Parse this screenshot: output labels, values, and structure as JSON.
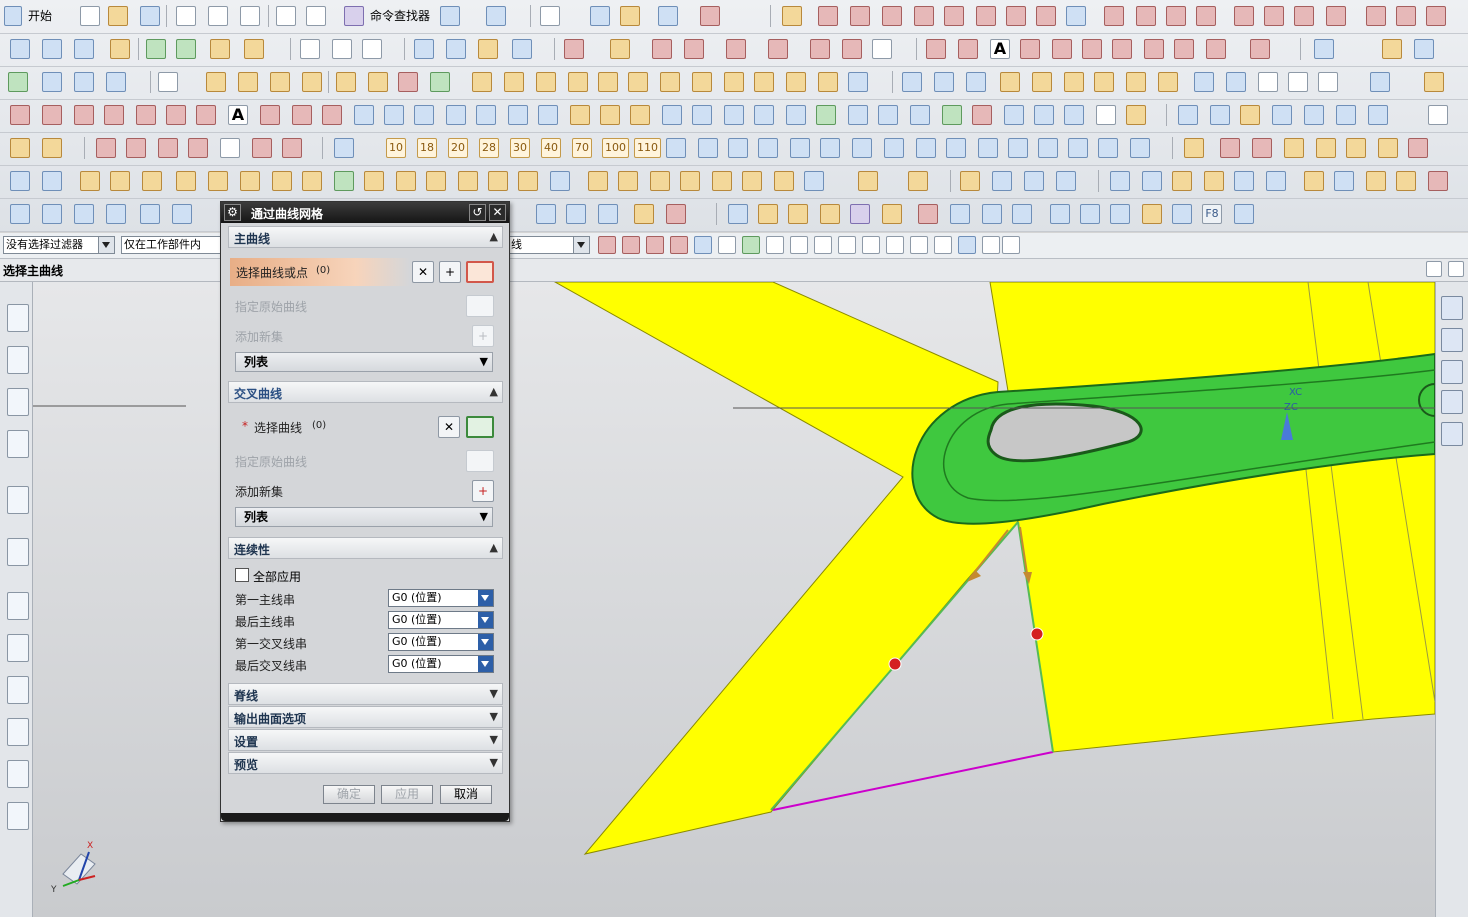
{
  "toolbar": {
    "start_label": "开始",
    "command_finder_label": "命令查找器",
    "number_buttons": [
      "10",
      "18",
      "20",
      "28",
      "30",
      "40",
      "70",
      "100",
      "110"
    ],
    "f8_label": "F8",
    "swatches": [
      "#ff00ff",
      "#e8001e",
      "#ff9a00",
      "#c8ff2a",
      "#10c020"
    ]
  },
  "filterbar": {
    "type_filter": "没有选择过滤器",
    "scope_filter": "仅在工作部件内",
    "curve_rule": "线"
  },
  "status": {
    "prompt": "选择主曲线"
  },
  "dialog": {
    "title": "通过曲线网格",
    "primary": {
      "header": "主曲线",
      "select_label": "选择曲线或点",
      "select_count": "(0)",
      "specify_origin": "指定原始曲线",
      "add_new_set": "添加新集",
      "list": "列表"
    },
    "cross": {
      "header": "交叉曲线",
      "required_mark": "*",
      "select_label": "选择曲线",
      "select_count": "(0)",
      "specify_origin": "指定原始曲线",
      "add_new_set": "添加新集",
      "list": "列表"
    },
    "continuity": {
      "header": "连续性",
      "apply_all": "全部应用",
      "rows": [
        {
          "label": "第一主线串",
          "value": "G0 (位置)"
        },
        {
          "label": "最后主线串",
          "value": "G0 (位置)"
        },
        {
          "label": "第一交叉线串",
          "value": "G0 (位置)"
        },
        {
          "label": "最后交叉线串",
          "value": "G0 (位置)"
        }
      ]
    },
    "collapsed_sections": [
      "脊线",
      "输出曲面选项",
      "设置",
      "预览"
    ],
    "buttons": {
      "ok": "确定",
      "apply": "应用",
      "cancel": "取消"
    }
  },
  "viewport": {
    "wcs_x": "XC",
    "wcs_z": "ZC",
    "triad_x": "X",
    "triad_y": "Y",
    "colors": {
      "surface": "#ffff00",
      "handle": "#3dcc3d",
      "edge": "#cc00cc",
      "marker": "#d42020"
    }
  }
}
